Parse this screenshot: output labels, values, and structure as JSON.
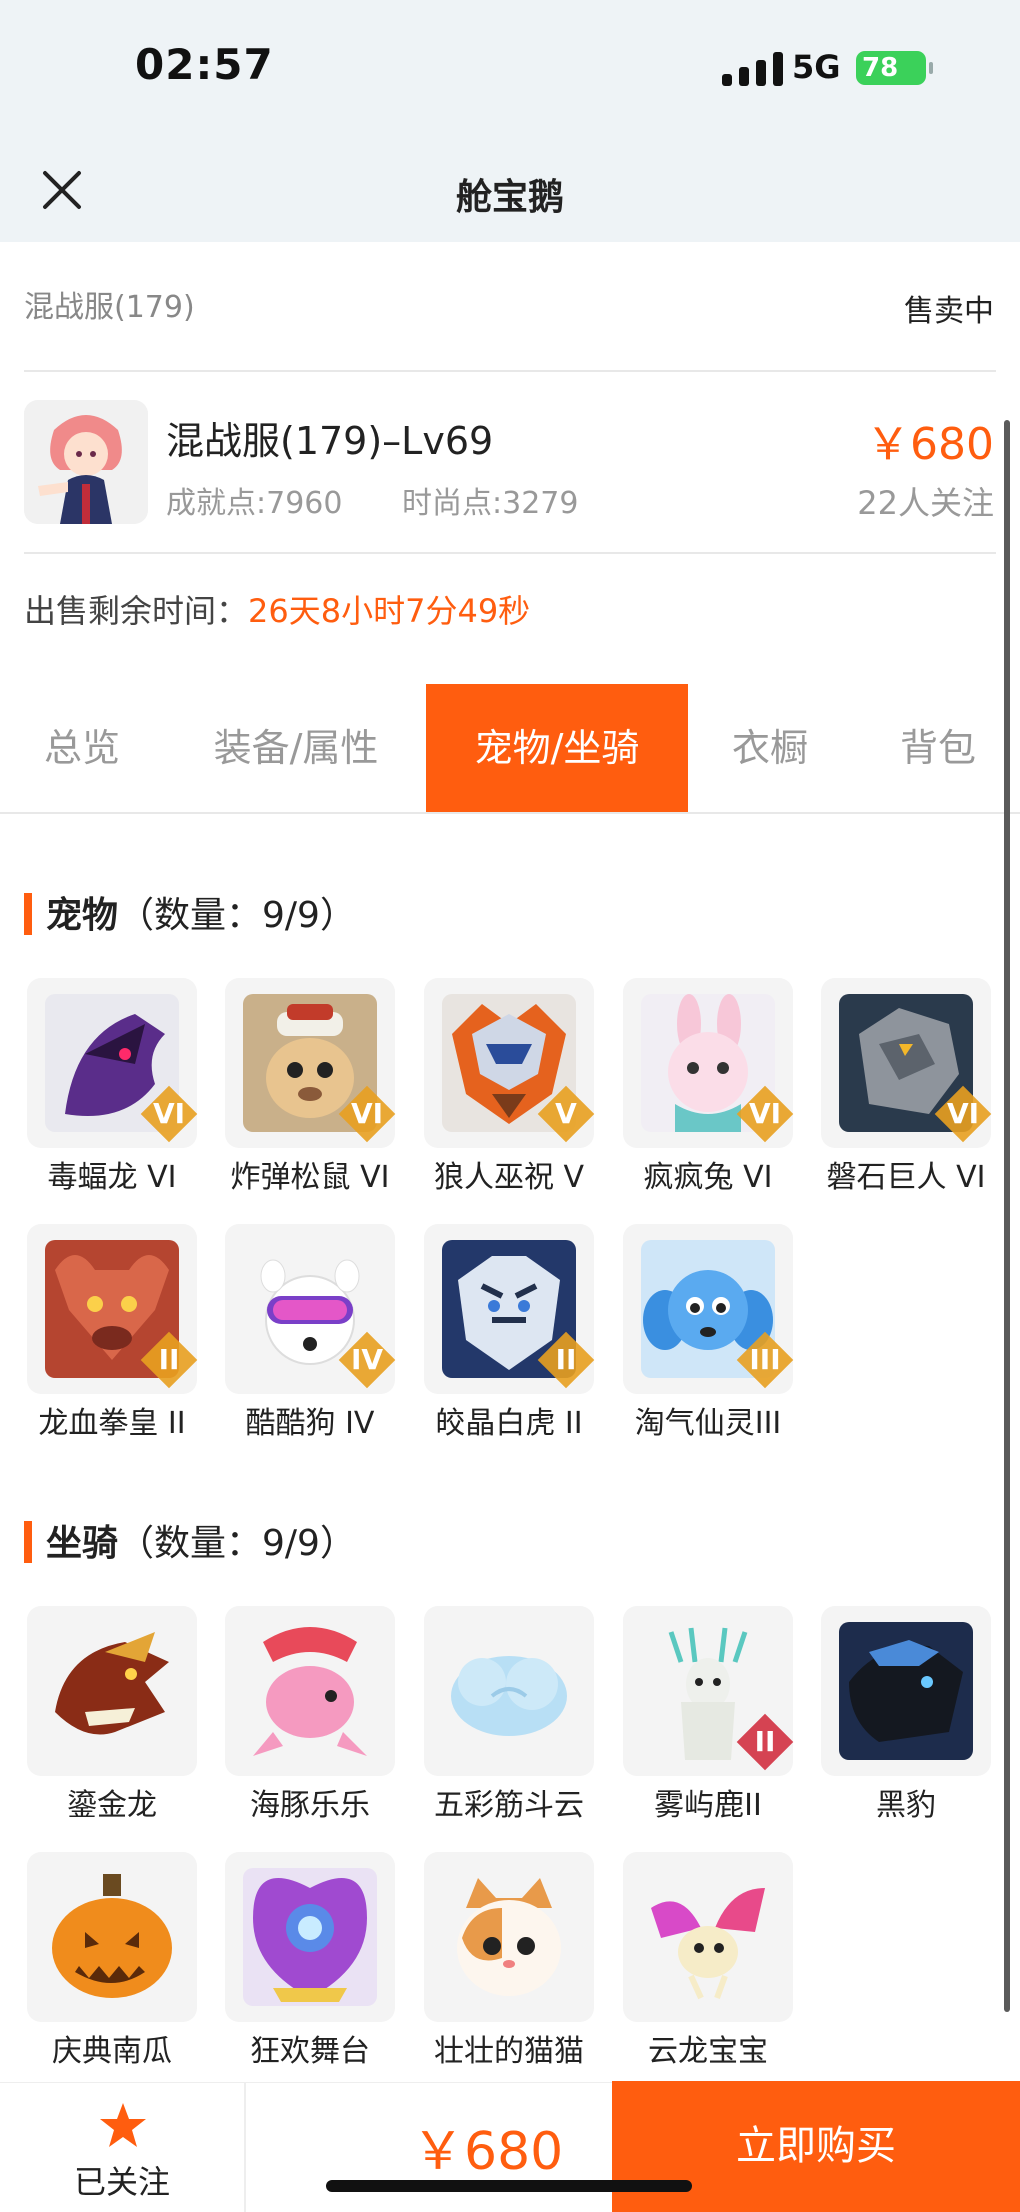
{
  "status": {
    "time": "02:57",
    "network": "5G",
    "battery": "78"
  },
  "nav": {
    "title": "舱宝鹅"
  },
  "listing": {
    "server": "混战服(179)",
    "sale_status": "售卖中",
    "role_title": "混战服(179)–Lv69",
    "achievement": "成就点:7960",
    "fashion": "时尚点:3279",
    "price": "￥680",
    "followers": "22人关注",
    "time_label": "出售剩余时间：",
    "time_value": "26天8小时7分49秒"
  },
  "tabs": [
    {
      "label": "总览"
    },
    {
      "label": "装备/属性"
    },
    {
      "label": "宠物/坐骑"
    },
    {
      "label": "衣橱"
    },
    {
      "label": "背包"
    }
  ],
  "active_tab": "宠物/坐骑",
  "pets": {
    "title": "宠物",
    "count": "（数量：9/9）",
    "items": [
      {
        "name": "毒蝠龙 VI",
        "badge": "VI",
        "icon": "purple-dragon-icon"
      },
      {
        "name": "炸弹松鼠 VI",
        "badge": "VI",
        "icon": "bomb-squirrel-icon"
      },
      {
        "name": "狼人巫祝 V",
        "badge": "V",
        "icon": "werewolf-shaman-icon"
      },
      {
        "name": "疯疯兔 VI",
        "badge": "VI",
        "icon": "crazy-rabbit-icon"
      },
      {
        "name": "磐石巨人 VI",
        "badge": "VI",
        "icon": "rock-giant-icon"
      },
      {
        "name": "龙血拳皇 II",
        "badge": "II",
        "icon": "dragon-boxer-icon"
      },
      {
        "name": "酷酷狗 IV",
        "badge": "IV",
        "icon": "cool-dog-icon"
      },
      {
        "name": "皎晶白虎 II",
        "badge": "II",
        "icon": "white-tiger-icon"
      },
      {
        "name": "淘气仙灵III",
        "badge": "III",
        "icon": "naughty-spirit-icon"
      }
    ]
  },
  "mounts": {
    "title": "坐骑",
    "count": "（数量：9/9）",
    "items": [
      {
        "name": "鎏金龙",
        "icon": "gold-dragon-icon"
      },
      {
        "name": "海豚乐乐",
        "icon": "dolphin-icon"
      },
      {
        "name": "五彩筋斗云",
        "icon": "cloud-icon"
      },
      {
        "name": "雾屿鹿II",
        "badge": "II",
        "icon": "deer-icon"
      },
      {
        "name": "黑豹",
        "icon": "black-panther-icon"
      },
      {
        "name": "庆典南瓜",
        "icon": "pumpkin-icon"
      },
      {
        "name": "狂欢舞台",
        "icon": "carnival-stage-icon"
      },
      {
        "name": "壮壮的猫猫",
        "icon": "cat-icon"
      },
      {
        "name": "云龙宝宝",
        "icon": "baby-dragon-icon"
      }
    ]
  },
  "bottom": {
    "follow_label": "已关注",
    "price": "￥680",
    "buy_label": "立即购买"
  },
  "colors": {
    "accent": "#ff5d0f",
    "badge_gold": "#e8a020",
    "badge_red": "#d23040"
  }
}
